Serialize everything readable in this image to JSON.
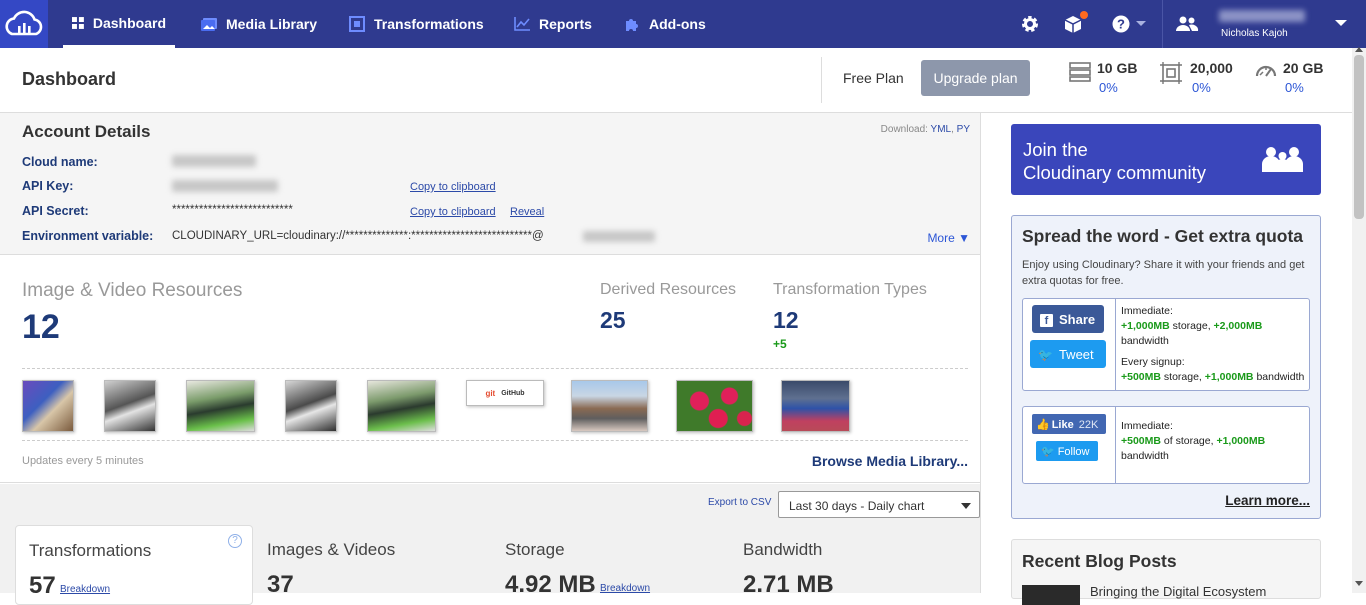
{
  "nav": {
    "items": [
      {
        "label": "Dashboard",
        "icon": "dashboard-icon"
      },
      {
        "label": "Media Library",
        "icon": "media-library-icon"
      },
      {
        "label": "Transformations",
        "icon": "transformations-icon"
      },
      {
        "label": "Reports",
        "icon": "reports-icon"
      },
      {
        "label": "Add-ons",
        "icon": "addons-puzzle-icon"
      }
    ],
    "user_name": "Nicholas Kajoh"
  },
  "header": {
    "title": "Dashboard",
    "plan": "Free Plan",
    "upgrade_label": "Upgrade plan",
    "quotas": [
      {
        "icon": "storage-icon",
        "value": "10 GB",
        "percent": "0%"
      },
      {
        "icon": "transformations-quota-icon",
        "value": "20,000",
        "percent": "0%"
      },
      {
        "icon": "bandwidth-icon",
        "value": "20 GB",
        "percent": "0%"
      }
    ]
  },
  "account": {
    "title": "Account Details",
    "download_label": "Download:",
    "download_yml": "YML",
    "download_py": "PY",
    "cloud_name_label": "Cloud name:",
    "api_key_label": "API Key:",
    "api_secret_label": "API Secret:",
    "api_secret_value": "***************************",
    "env_label": "Environment variable:",
    "env_value": "CLOUDINARY_URL=cloudinary://**************:***************************@",
    "copy_label": "Copy to clipboard",
    "reveal_label": "Reveal",
    "more_label": "More ▼"
  },
  "resources": {
    "image_video_label": "Image & Video Resources",
    "image_video_count": "12",
    "derived_label": "Derived Resources",
    "derived_count": "25",
    "transformation_types_label": "Transformation Types",
    "transformation_types_count": "12",
    "transformation_types_delta": "+5",
    "updates_note": "Updates every 5 minutes",
    "browse_label": "Browse Media Library...",
    "thumbnail_logo_text_git": "git",
    "thumbnail_logo_text_github": "GitHub"
  },
  "stats": {
    "export_label": "Export to CSV",
    "range_selected": "Last 30 days - Daily chart",
    "cards": [
      {
        "label": "Transformations",
        "value": "57",
        "breakdown": "Breakdown"
      },
      {
        "label": "Images & Videos",
        "value": "37"
      },
      {
        "label": "Storage",
        "value": "4.92 MB",
        "breakdown": "Breakdown"
      },
      {
        "label": "Bandwidth",
        "value": "2.71 MB"
      }
    ]
  },
  "sidebar": {
    "join_line1": "Join the",
    "join_line2": "Cloudinary community",
    "spread_title": "Spread the word - Get extra quota",
    "spread_desc": "Enjoy using Cloudinary? Share it with your friends and get extra quotas for free.",
    "share_label": "Share",
    "tweet_label": "Tweet",
    "immediate_label": "Immediate:",
    "share_storage": "+1,000MB",
    "storage_word": "storage,",
    "share_bandwidth": "+2,000MB",
    "bandwidth_word": "bandwidth",
    "every_signup_label": "Every signup:",
    "signup_storage": "+500MB",
    "signup_bandwidth": "+1,000MB",
    "like_label": "Like",
    "like_count": "22K",
    "follow_label": "Follow",
    "follow_storage": "+500MB",
    "of_storage_word": "of storage,",
    "follow_bandwidth": "+1,000MB",
    "learn_more": "Learn more...",
    "blog_title": "Recent Blog Posts",
    "blog_post_title": "Bringing the Digital Ecosystem"
  },
  "colors": {
    "nav_bg": "#2f3a8f",
    "logo_bg": "#3448c5",
    "accent_blue": "#2c56d6",
    "join_bg": "#3a46bb",
    "green": "#1a9a1a"
  }
}
